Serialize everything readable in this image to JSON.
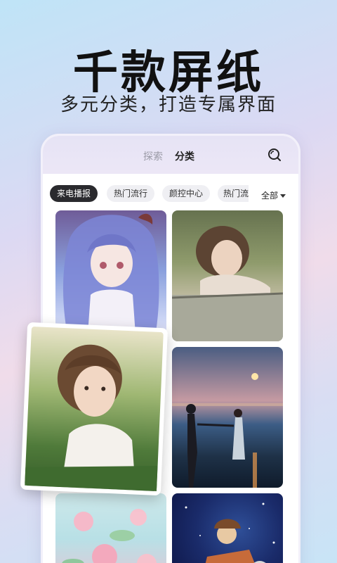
{
  "promo": {
    "headline": "千款屏纸",
    "subline": "多元分类，打造专属界面"
  },
  "app": {
    "tabs": {
      "explore": "探索",
      "category": "分类"
    },
    "chips": [
      {
        "label": "来电播报",
        "active": true
      },
      {
        "label": "热门流行",
        "active": false
      },
      {
        "label": "颜控中心",
        "active": false
      },
      {
        "label": "热门流",
        "active": false
      }
    ],
    "more_label": "全部",
    "icons": {
      "search": "search-icon",
      "more": "caret-down-icon"
    },
    "colors": {
      "active_chip": "#2a2a2e",
      "chip": "#efeff3",
      "header": "#e6e3f5"
    }
  }
}
